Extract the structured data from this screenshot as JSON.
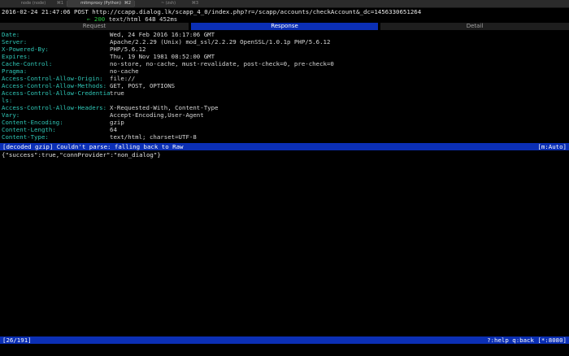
{
  "tabs": [
    {
      "label": "node (node)",
      "shortcut": "⌘1"
    },
    {
      "label": "mitmproxy (Python)",
      "shortcut": "⌘2"
    },
    {
      "label": "~ (zsh)",
      "shortcut": "⌘3"
    }
  ],
  "request": {
    "datetime": "2016-02-24 21:47:06",
    "method": "POST",
    "url": "http://ccapp.dialog.lk/scapp_4_0/index.php?r=/scapp/accounts/checkAccount&_dc=1456330651264"
  },
  "response_summary": {
    "arrow": "←",
    "code": "200",
    "info": "text/html 64B 452ms"
  },
  "view_tabs": [
    "Request",
    "Response",
    "Detail"
  ],
  "headers": [
    {
      "name": "Date:",
      "value": "Wed, 24 Feb 2016 16:17:06 GMT"
    },
    {
      "name": "Server:",
      "value": "Apache/2.2.29 (Unix) mod_ssl/2.2.29 OpenSSL/1.0.1p PHP/5.6.12"
    },
    {
      "name": "X-Powered-By:",
      "value": "PHP/5.6.12"
    },
    {
      "name": "Expires:",
      "value": "Thu, 19 Nov 1981 08:52:00 GMT"
    },
    {
      "name": "Cache-Control:",
      "value": "no-store, no-cache, must-revalidate, post-check=0, pre-check=0"
    },
    {
      "name": "Pragma:",
      "value": "no-cache"
    },
    {
      "name": "Access-Control-Allow-Origin:",
      "value": "file://"
    },
    {
      "name": "Access-Control-Allow-Methods:",
      "value": "GET, POST, OPTIONS"
    },
    {
      "name": "Access-Control-Allow-Credentia",
      "value": "true"
    },
    {
      "name": "ls:",
      "value": ""
    },
    {
      "name": "Access-Control-Allow-Headers:",
      "value": "X-Requested-With, Content-Type"
    },
    {
      "name": "Vary:",
      "value": "Accept-Encoding,User-Agent"
    },
    {
      "name": "Content-Encoding:",
      "value": "gzip"
    },
    {
      "name": "Content-Length:",
      "value": "64"
    },
    {
      "name": "Content-Type:",
      "value": "text/html; charset=UTF-8"
    }
  ],
  "decode_bar": {
    "left": "[decoded gzip] Couldn't parse: falling back to Raw",
    "right": "[m:Auto]"
  },
  "body": "{\"success\":true,\"connProvider\":\"non_dialog\"}",
  "bottom_bar": {
    "left": "[26/191]",
    "right": "?:help q:back [*:8080]"
  }
}
